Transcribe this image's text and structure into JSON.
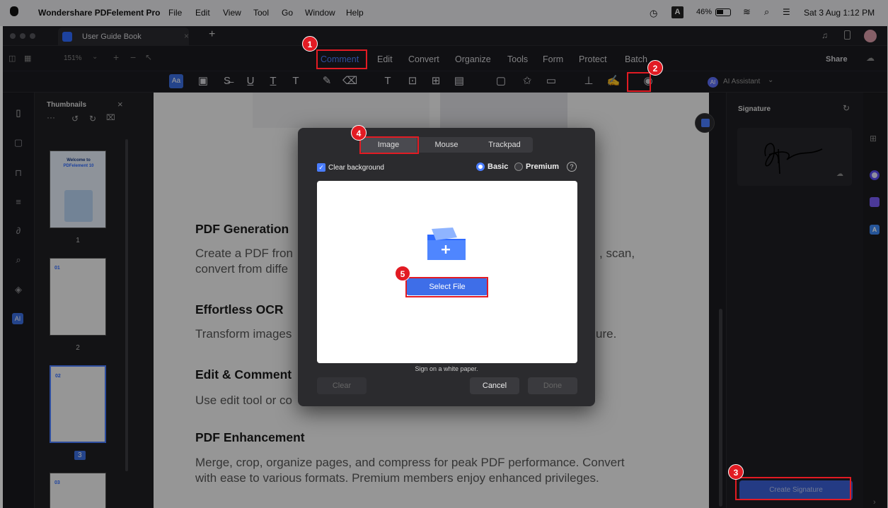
{
  "menubar": {
    "app_name": "Wondershare PDFelement Pro",
    "items": [
      "File",
      "Edit",
      "View",
      "Tool",
      "Go",
      "Window",
      "Help"
    ],
    "input_source": "A",
    "battery": "46%",
    "datetime": "Sat 3 Aug  1:12 PM"
  },
  "tab": {
    "title": "User Guide Book"
  },
  "toolbar": {
    "zoom": "151%",
    "main_tabs": [
      "Comment",
      "Edit",
      "Convert",
      "Organize",
      "Tools",
      "Form",
      "Protect",
      "Batch"
    ],
    "share_label": "Share",
    "ai_assistant_label": "AI Assistant"
  },
  "thumbnails": {
    "title": "Thumbnails",
    "page_numbers": [
      "1",
      "2",
      "3"
    ],
    "cover_lines": [
      "Welcome to",
      "PDFelement 10"
    ],
    "page_labels": [
      "01",
      "02",
      "03"
    ]
  },
  "document": {
    "sections": [
      {
        "title": "PDF Generation",
        "text": "Create a PDF fron",
        "text_right": ", scan,",
        "line2": "convert from diffe"
      },
      {
        "title": "Effortless OCR",
        "text": "Transform images",
        "text_right": "ure."
      },
      {
        "title": "Edit & Comment",
        "text": "Use edit tool or co"
      },
      {
        "title": "PDF Enhancement",
        "text": "Merge, crop, organize pages, and compress for peak PDF performance. Convert with ease to various formats. Premium members enjoy enhanced privileges."
      }
    ]
  },
  "signature_panel": {
    "title": "Signature",
    "create_label": "Create Signature"
  },
  "dialog": {
    "tabs": [
      "Image",
      "Mouse",
      "Trackpad"
    ],
    "active_tab": "Image",
    "clear_background_label": "Clear background",
    "clear_background_checked": true,
    "mode_basic": "Basic",
    "mode_premium": "Premium",
    "selected_mode": "Basic",
    "select_file_label": "Select File",
    "hint": "Sign on a white paper.",
    "clear_label": "Clear",
    "cancel_label": "Cancel",
    "done_label": "Done"
  },
  "callouts": [
    "1",
    "2",
    "3",
    "4",
    "5"
  ],
  "colors": {
    "accent": "#4a7dff",
    "callout_red": "#e21b23",
    "dark_bg": "#1b1b1f",
    "dialog_bg": "#2b2b2e"
  }
}
